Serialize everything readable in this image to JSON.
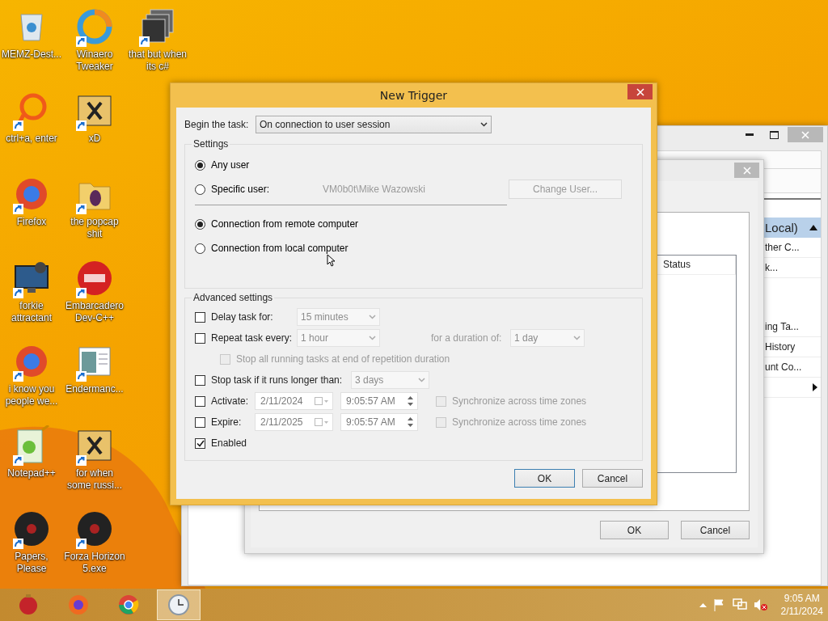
{
  "desktop_icons": [
    {
      "label": "MEMZ-Dest...",
      "kind": "bin",
      "shortcut": false
    },
    {
      "label": "ctrl+a, enter",
      "kind": "ring",
      "shortcut": true
    },
    {
      "label": "Firefox",
      "kind": "browser",
      "shortcut": true
    },
    {
      "label": "forkie attractant",
      "kind": "monitor",
      "shortcut": true
    },
    {
      "label": "i know you people we...",
      "kind": "browser",
      "shortcut": true
    },
    {
      "label": "Notepad++",
      "kind": "notepad",
      "shortcut": true
    },
    {
      "label": "Papers, Please",
      "kind": "disc",
      "shortcut": true
    },
    {
      "label": "Winaero Tweaker",
      "kind": "swirl",
      "shortcut": true
    },
    {
      "label": "xD",
      "kind": "app",
      "shortcut": true
    },
    {
      "label": "the popcap shit",
      "kind": "folder",
      "shortcut": true
    },
    {
      "label": "Embarcadero Dev-C++",
      "kind": "badge",
      "shortcut": true
    },
    {
      "label": "Endermanc...",
      "kind": "window",
      "shortcut": true
    },
    {
      "label": "for when some russi...",
      "kind": "app",
      "shortcut": true
    },
    {
      "label": "Forza Horizon 5.exe",
      "kind": "disc",
      "shortcut": true
    },
    {
      "label": "that but when its c#",
      "kind": "stack",
      "shortcut": true
    }
  ],
  "background_window": {
    "action_pane": {
      "header": "Local)",
      "items": [
        {
          "label": "ther C...",
          "submenu": false
        },
        {
          "label": "k...",
          "submenu": false
        },
        {
          "submenu": false,
          "spacer": true
        },
        {
          "label": "ing Ta...",
          "submenu": false
        },
        {
          "label": "History",
          "submenu": false
        },
        {
          "label": "unt Co...",
          "submenu": false
        },
        {
          "submenu": true
        }
      ]
    },
    "dialog": {
      "column": "Status",
      "buttons": [
        "OK",
        "Cancel"
      ]
    }
  },
  "new_trigger": {
    "title": "New Trigger",
    "begin": {
      "label": "Begin the task:",
      "value": "On connection to user session"
    },
    "settings": {
      "title": "Settings",
      "user_options": [
        {
          "label": "Any user",
          "selected": true
        },
        {
          "label": "Specific user:",
          "selected": false
        }
      ],
      "user_name": {
        "text": "VM0b0t\\Mike Wazowski",
        "disabled": true
      },
      "change_user": {
        "label": "Change User...",
        "disabled": true
      },
      "connection_options": [
        {
          "label": "Connection from remote computer",
          "selected": true
        },
        {
          "label": "Connection from local computer",
          "selected": false
        }
      ]
    },
    "advanced": {
      "title": "Advanced settings",
      "delay": {
        "label": "Delay task for:",
        "checked": false,
        "value": "15 minutes",
        "disabled": true
      },
      "repeat": {
        "label": "Repeat task every:",
        "checked": false,
        "value": "1 hour",
        "disabled": true,
        "duration_label": "for a duration of:",
        "duration_value": "1 day"
      },
      "stop_all": {
        "label": "Stop all running tasks at end of repetition duration",
        "checked": false,
        "disabled": true
      },
      "stop_longer": {
        "label": "Stop task if it runs longer than:",
        "checked": false,
        "value": "3 days",
        "disabled": true
      },
      "schedule": [
        {
          "label": "Activate:",
          "checked": false,
          "date": "2/11/2024",
          "time": "9:05:57 AM",
          "disabled": true,
          "sync": {
            "label": "Synchronize across time zones",
            "checked": false,
            "disabled": true
          }
        },
        {
          "label": "Expire:",
          "checked": false,
          "date": "2/11/2025",
          "time": "9:05:57 AM",
          "disabled": true,
          "sync": {
            "label": "Synchronize across time zones",
            "checked": false,
            "disabled": true
          }
        }
      ],
      "enabled": {
        "label": "Enabled",
        "checked": true
      }
    },
    "buttons": [
      {
        "label": "OK",
        "default": true
      },
      {
        "label": "Cancel",
        "default": false
      }
    ]
  },
  "taskbar": {
    "apps": [
      {
        "kind": "ornament",
        "selected": false
      },
      {
        "kind": "fox",
        "selected": false
      },
      {
        "kind": "chrome",
        "selected": false
      },
      {
        "kind": "clock",
        "selected": true
      }
    ],
    "time": "9:05 AM",
    "date": "2/11/2024"
  }
}
